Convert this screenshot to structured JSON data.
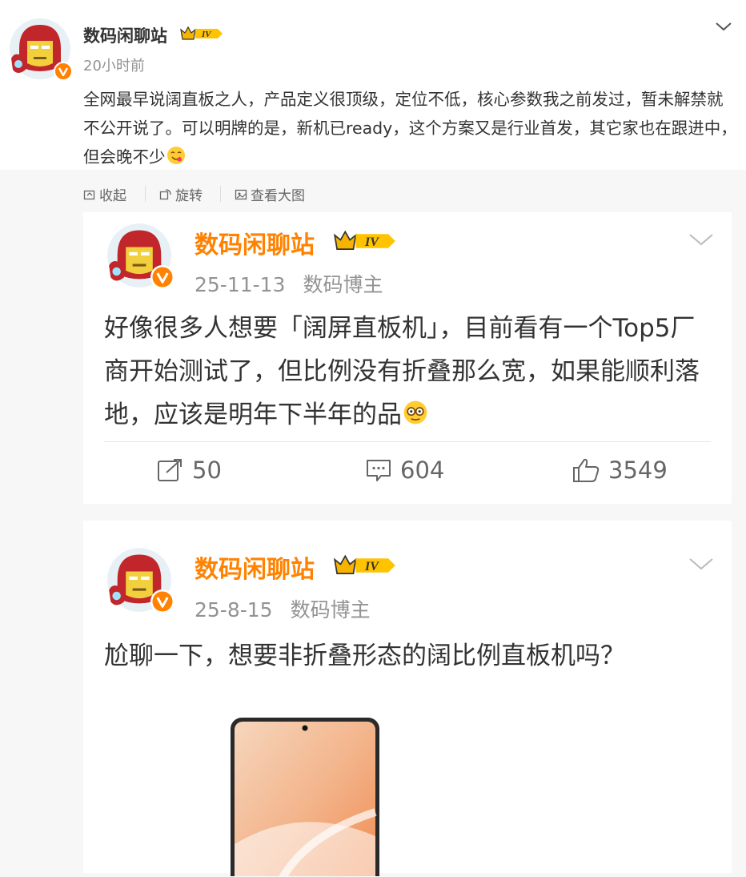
{
  "top_post": {
    "author": "数码闲聊站",
    "time": "20小时前",
    "text": "全网最早说阔直板之人，产品定义很顶级，定位不低，核心参数我之前发过，暂未解禁就不公开说了。可以明牌的是，新机已ready，这个方案又是行业首发，其它家也在跟进中，但会晚不少",
    "badge_level": "IV"
  },
  "toolbar": {
    "collapse_label": "收起",
    "rotate_label": "旋转",
    "view_large_label": "查看大图"
  },
  "retweets": [
    {
      "author": "数码闲聊站",
      "date": "25-11-13",
      "role": "数码博主",
      "text": "好像很多人想要「阔屏直板机」，目前看有一个Top5厂商开始测试了，但比例没有折叠那么宽，如果能顺利落地，应该是明年下半年的品",
      "reposts": "50",
      "comments": "604",
      "likes": "3549"
    },
    {
      "author": "数码闲聊站",
      "date": "25-8-15",
      "role": "数码博主",
      "text": "尬聊一下，想要非折叠形态的阔比例直板机吗？"
    }
  ],
  "colors": {
    "author_orange": "#ff8200",
    "muted_grey": "#939393",
    "verified_badge": "#ff8200",
    "background_grey": "#f7f7f7"
  },
  "icons": [
    "chevron-down-icon",
    "collapse-icon",
    "rotate-icon",
    "view-large-icon",
    "repost-icon",
    "comment-icon",
    "like-icon",
    "verified-icon",
    "crown-badge-icon"
  ]
}
